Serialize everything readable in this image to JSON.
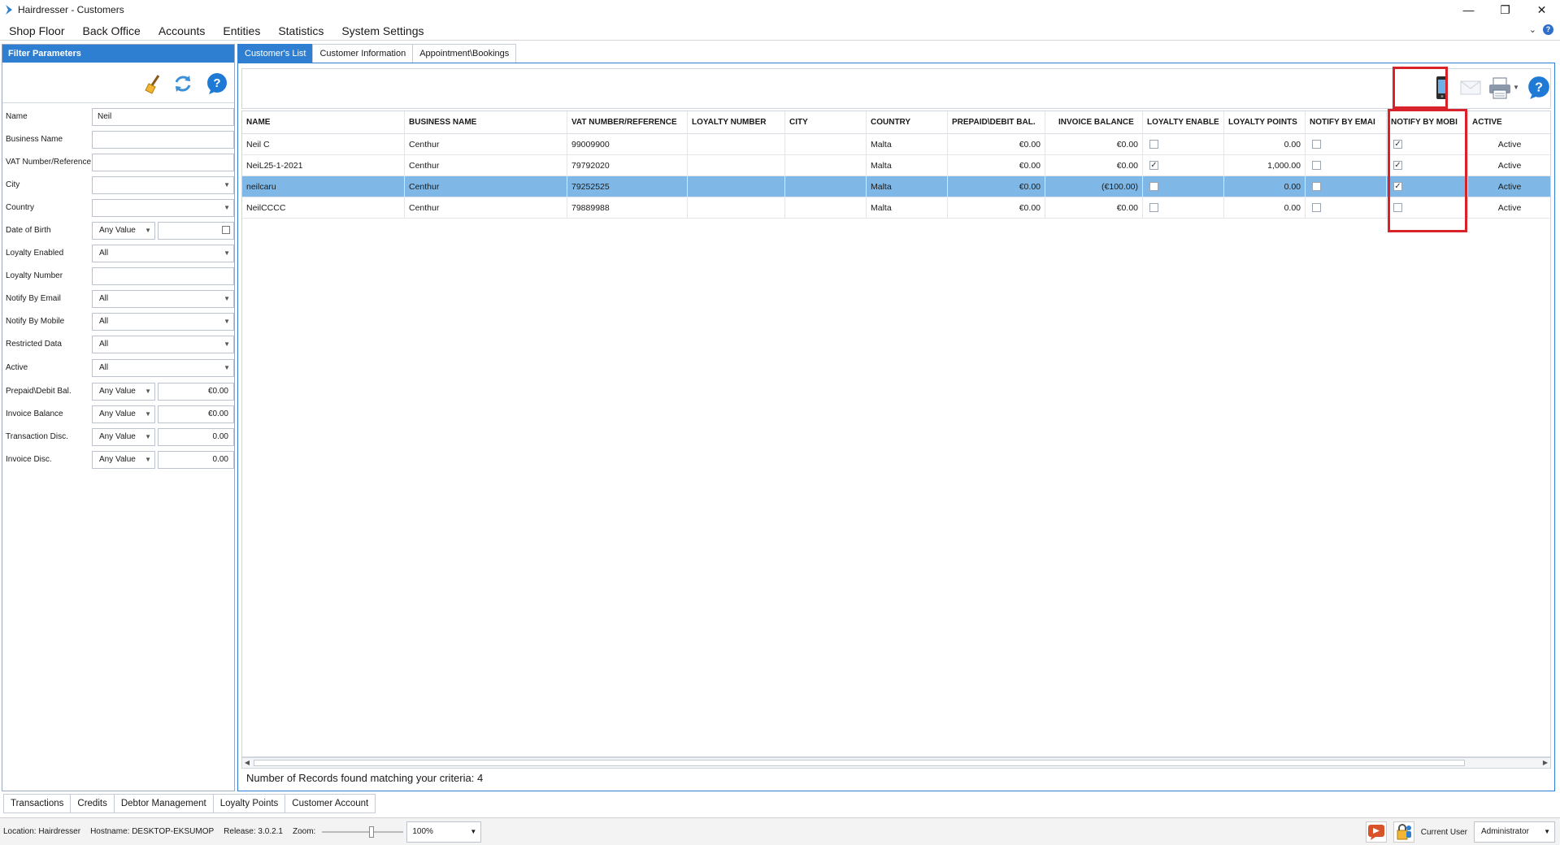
{
  "window": {
    "title": "Hairdresser - Customers",
    "controls": [
      "—",
      "❐",
      "✕"
    ]
  },
  "menu": [
    "Shop Floor",
    "Back Office",
    "Accounts",
    "Entities",
    "Statistics",
    "System Settings"
  ],
  "filter": {
    "header": "Filter Parameters",
    "fields": {
      "name": {
        "label": "Name",
        "value": "Neil"
      },
      "business_name": {
        "label": "Business Name",
        "value": ""
      },
      "vat": {
        "label": "VAT Number/Reference",
        "value": ""
      },
      "city": {
        "label": "City",
        "value": ""
      },
      "country": {
        "label": "Country",
        "value": ""
      },
      "dob": {
        "label": "Date of Birth",
        "value": "Any Value"
      },
      "loyalty_enabled": {
        "label": "Loyalty Enabled",
        "value": "All"
      },
      "loyalty_number": {
        "label": "Loyalty Number",
        "value": ""
      },
      "notify_email": {
        "label": "Notify By Email",
        "value": "All"
      },
      "notify_mobile": {
        "label": "Notify By Mobile",
        "value": "All"
      },
      "restricted": {
        "label": "Restricted Data",
        "value": "All"
      },
      "active": {
        "label": "Active",
        "value": "All"
      },
      "prepaid": {
        "label": "Prepaid\\Debit Bal.",
        "value": "Any Value",
        "amount": "€0.00"
      },
      "invoice_balance": {
        "label": "Invoice Balance",
        "value": "Any Value",
        "amount": "€0.00"
      },
      "transaction_disc": {
        "label": "Transaction Disc.",
        "value": "Any Value",
        "amount": "0.00"
      },
      "invoice_disc": {
        "label": "Invoice Disc.",
        "value": "Any Value",
        "amount": "0.00"
      }
    }
  },
  "tabs": [
    "Customer's List",
    "Customer Information",
    "Appointment\\Bookings"
  ],
  "grid": {
    "columns": [
      "NAME",
      "BUSINESS NAME",
      "VAT NUMBER/REFERENCE",
      "LOYALTY NUMBER",
      "CITY",
      "COUNTRY",
      "PREPAID\\DEBIT BAL.",
      "INVOICE BALANCE",
      "LOYALTY ENABLE",
      "LOYALTY POINTS",
      "NOTIFY BY EMAI",
      "NOTIFY BY MOBI",
      "ACTIVE"
    ],
    "rows": [
      {
        "name": "Neil C",
        "business": "Centhur",
        "vat": "99009900",
        "loyalty_no": "",
        "city": "",
        "country": "Malta",
        "prepaid": "€0.00",
        "invoice": "€0.00",
        "loyalty_enabled": false,
        "points": "0.00",
        "notify_email": false,
        "notify_mobile": true,
        "active": "Active"
      },
      {
        "name": "NeiL25-1-2021",
        "business": "Centhur",
        "vat": "79792020",
        "loyalty_no": "",
        "city": "",
        "country": "Malta",
        "prepaid": "€0.00",
        "invoice": "€0.00",
        "loyalty_enabled": true,
        "points": "1,000.00",
        "notify_email": false,
        "notify_mobile": true,
        "active": "Active"
      },
      {
        "name": "neilcaru",
        "business": "Centhur",
        "vat": "79252525",
        "loyalty_no": "",
        "city": "",
        "country": "Malta",
        "prepaid": "€0.00",
        "invoice": "(€100.00)",
        "loyalty_enabled": false,
        "points": "0.00",
        "notify_email": false,
        "notify_mobile": true,
        "active": "Active"
      },
      {
        "name": "NeilCCCC",
        "business": "Centhur",
        "vat": "79889988",
        "loyalty_no": "",
        "city": "",
        "country": "Malta",
        "prepaid": "€0.00",
        "invoice": "€0.00",
        "loyalty_enabled": false,
        "points": "0.00",
        "notify_email": false,
        "notify_mobile": false,
        "active": "Active"
      }
    ]
  },
  "records_text": "Number of Records found matching your criteria: 4",
  "bottom_tabs": [
    "Transactions",
    "Credits",
    "Debtor Management",
    "Loyalty Points",
    "Customer Account"
  ],
  "status": {
    "location_label": "Location:",
    "location": "Hairdresser",
    "hostname_label": "Hostname:",
    "hostname": "DESKTOP-EKSUMOP",
    "release_label": "Release:",
    "release": "3.0.2.1",
    "zoom_label": "Zoom:",
    "zoom": "100%",
    "current_user_label": "Current User",
    "current_user": "Administrator"
  },
  "colors": {
    "accent": "#2e7fd2",
    "selected_row": "#7fb8e6",
    "highlight": "#d8232a"
  }
}
